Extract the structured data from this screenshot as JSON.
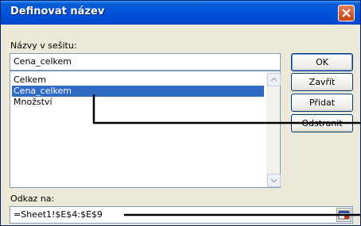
{
  "window": {
    "title": "Definovat název"
  },
  "names_label": "Názvy v sešitu:",
  "name_input": {
    "value": "Cena_celkem"
  },
  "names_list": [
    "Celkem",
    "Cena_celkem",
    "Množství"
  ],
  "buttons": {
    "ok": "OK",
    "close": "Zavřít",
    "add": "Přidat",
    "delete": "Odstranit"
  },
  "ref_label": "Odkaz na:",
  "ref_input": {
    "value": "=Sheet1!$E$4:$E$9"
  },
  "colors": {
    "selection": "#316ac5",
    "titlebar": "#0050d8",
    "dialog_bg": "#ece9d8"
  }
}
